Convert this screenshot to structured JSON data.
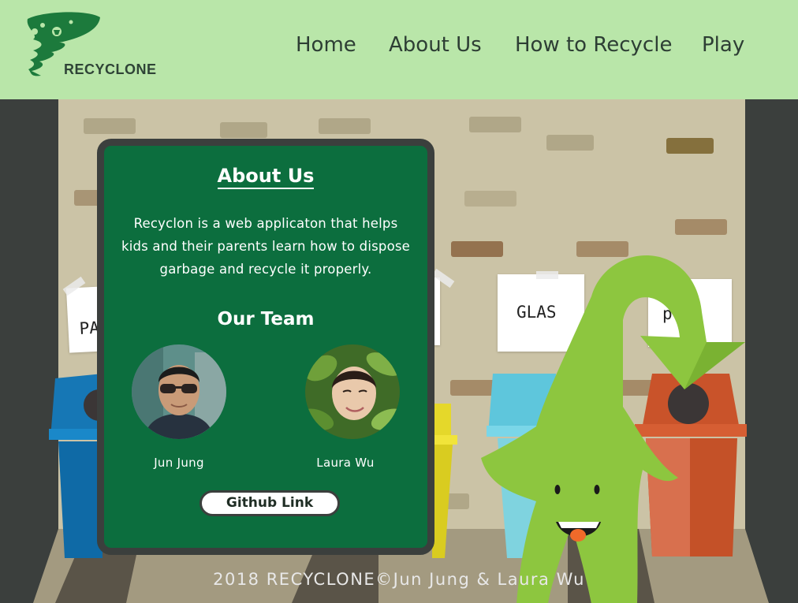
{
  "header": {
    "logo_text": "RECYCLONE",
    "nav": [
      "Home",
      "About Us",
      "How to Recycle",
      "Play"
    ]
  },
  "scene": {
    "signs": [
      "PA",
      "GLAS",
      "p"
    ],
    "mascot": "green-arrow-mascot-icon"
  },
  "modal": {
    "title": "About Us",
    "description": "Recyclon is a web applicaton that helps kids and their parents learn how to dispose garbage and recycle it properly.",
    "team_title": "Our Team",
    "members": [
      {
        "name": "Jun Jung",
        "photo": "man-with-sunglasses-photo"
      },
      {
        "name": "Laura Wu",
        "photo": "woman-in-leaves-photo"
      }
    ],
    "github_label": "Github Link"
  },
  "footer": {
    "text": "2018 RECYCLONE©Jun Jung & Laura Wu"
  },
  "colors": {
    "header_bg": "#b9e6a9",
    "modal_bg": "#0c6e3e",
    "wall": "#cbc3a6",
    "mascot": "#8dc63f"
  }
}
